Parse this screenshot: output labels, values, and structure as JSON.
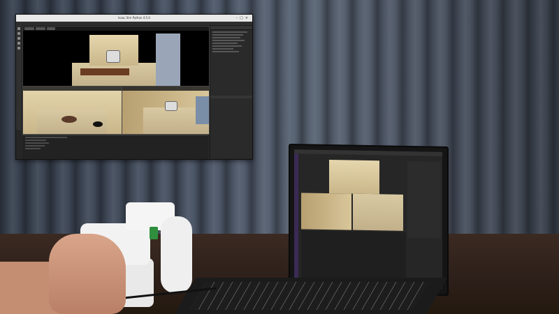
{
  "scene": {
    "type": "photo",
    "subject": "hand operating teleoperation controller with simulator on laptop",
    "colors": {
      "curtain": "#4b5566",
      "table": "#2c1f19",
      "device": "#f2f2f2",
      "accent_green": "#2f8f3c"
    }
  },
  "overlay_window": {
    "title": "Isaac Sim Python 4.5.0",
    "icons": [
      "minimize-icon",
      "maximize-icon",
      "close-icon"
    ]
  }
}
